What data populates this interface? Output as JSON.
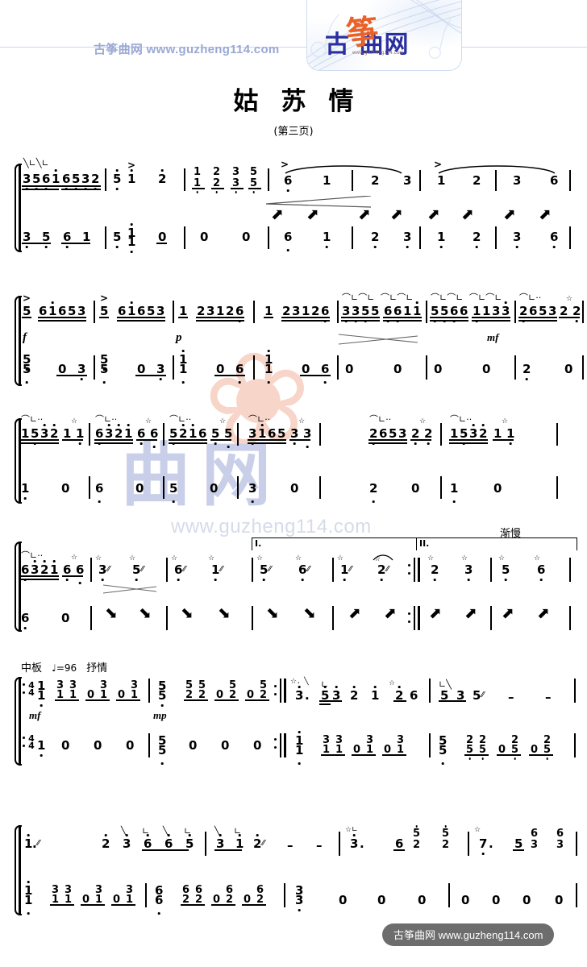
{
  "header": {
    "watermark_text": "古筝曲网  www.guzheng114.com",
    "logo_han": "古  曲网",
    "logo_zheng": "筝",
    "logo_url": "www.guzheng114.com"
  },
  "title": "姑苏情",
  "subtitle": "(第三页)",
  "watermarks": {
    "center_text": "曲网",
    "center_url": "www.guzheng114.com"
  },
  "footer": {
    "text": "古筝曲网  www.guzheng114.com"
  },
  "markings": {
    "tempo_cn": "中板",
    "tempo_note": "♩=96",
    "expression_cn": "抒情",
    "ritard_cn": "渐慢",
    "volta1": "I.",
    "volta2": "II.",
    "time_signature_top": "4",
    "time_signature_bottom": "4"
  },
  "dynamics": [
    "f",
    "p",
    "mf",
    "mf",
    "mp"
  ],
  "chart_data": {
    "type": "table",
    "title": "姑苏情 (第三页) — 古筝双行简谱",
    "notation": "jianpu / numbered musical notation",
    "tempo": "中板 ♩=96 抒情",
    "systems": [
      {
        "index": 1,
        "upper_measures": [
          "3 5 6 1 6 5 3 2",
          "5  1",
          "2",
          "1 2 3 5 / 1 2 3 5",
          "6   1",
          "2   3",
          "1   2",
          "3   6"
        ],
        "lower_measures": [
          "3 5 6 1",
          "5  1",
          "0  |  0   0",
          "6   1",
          "2   3",
          "1   2",
          "3   6"
        ],
        "dynamics": [],
        "marks": [
          "accent >",
          "crescendo hairpin",
          "slur"
        ]
      },
      {
        "index": 2,
        "upper_measures": [
          "5 61653",
          "5 61653",
          "1 23126",
          "1 23126",
          "3355 6611",
          "5566 1133",
          "2653 2 2"
        ],
        "lower_measures": [
          "5/5  0 3",
          "5/5  0 3",
          "1/1  0 6",
          "1/1  0 6",
          "0  0",
          "0  0",
          "2  0"
        ],
        "dynamics": [
          "f",
          "p",
          "mf"
        ],
        "marks": [
          "accent >",
          "crescendo-decrescendo hairpin"
        ]
      },
      {
        "index": 3,
        "upper_measures": [
          "1532 1 1",
          "6321 6 6",
          "5216 5 5",
          "3165 3 3",
          "2653 2 2",
          "1532 1 1"
        ],
        "lower_measures": [
          "1 0",
          "6 0",
          "5 0",
          "3 0",
          "2 0",
          "1 0"
        ],
        "dynamics": [],
        "marks": []
      },
      {
        "index": 4,
        "upper_measures": [
          "6321 6 6",
          "3  5",
          "6  1",
          "5  6",
          "1  2",
          "2  3",
          "5  6"
        ],
        "lower_measures": [
          "6 0",
          "↓ ↓",
          "↓ ↓",
          "↓ ↓",
          "↓ ↓",
          "↑ ↑",
          "↑ ↑"
        ],
        "dynamics": [],
        "marks": [
          "volta I.",
          "volta II.",
          "渐慢",
          "repeat barline",
          "decrescendo hairpin"
        ]
      },
      {
        "index": 5,
        "upper_measures": [
          "1/1 31/11 30/01 30/01",
          "5/5 52/22 50/02 50/02",
          "3. 53 2 1 2 6",
          "5 3 5 - -"
        ],
        "lower_measures": [
          "1 0 0 0",
          "5 0 0 0",
          "1/1 31/11 30/01 30/01",
          "5/5 22/55 20/05 20/05"
        ],
        "dynamics": [
          "mf",
          "mp"
        ],
        "marks": [
          "4/4 time signature",
          "repeat start",
          "repeat end"
        ]
      },
      {
        "index": 6,
        "upper_measures": [
          "1.",
          "2 3 6 6 5",
          "3 1 2 - -",
          "3.",
          "3. 6 52 52",
          "7. 5 63 63"
        ],
        "lower_measures": [
          "1/1 31/11 30/01 30/01",
          "6/6 62/22 60/02 60/02",
          "3/3  0 0 0",
          "0 0 0 0"
        ],
        "dynamics": [],
        "marks": [
          "volta 1."
        ]
      }
    ]
  }
}
